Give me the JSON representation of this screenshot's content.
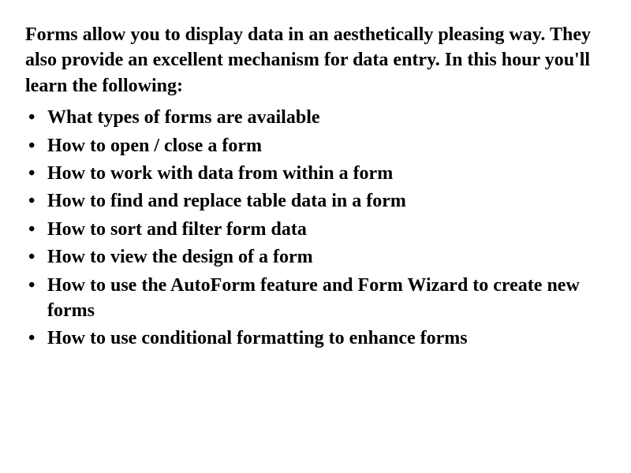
{
  "intro": "Forms allow you to display data in an aesthetically pleasing way. They also provide an excellent mechanism for data entry. In this hour you'll learn the following:",
  "items": [
    "What types of forms are available",
    "How to open / close a form",
    "How to work with data from within a form",
    "How to find and replace table data in a form",
    "How to sort and filter form data",
    "How to view the design of a form",
    "How to use the AutoForm feature and Form Wizard to create new forms",
    "How to use conditional formatting to enhance forms"
  ]
}
